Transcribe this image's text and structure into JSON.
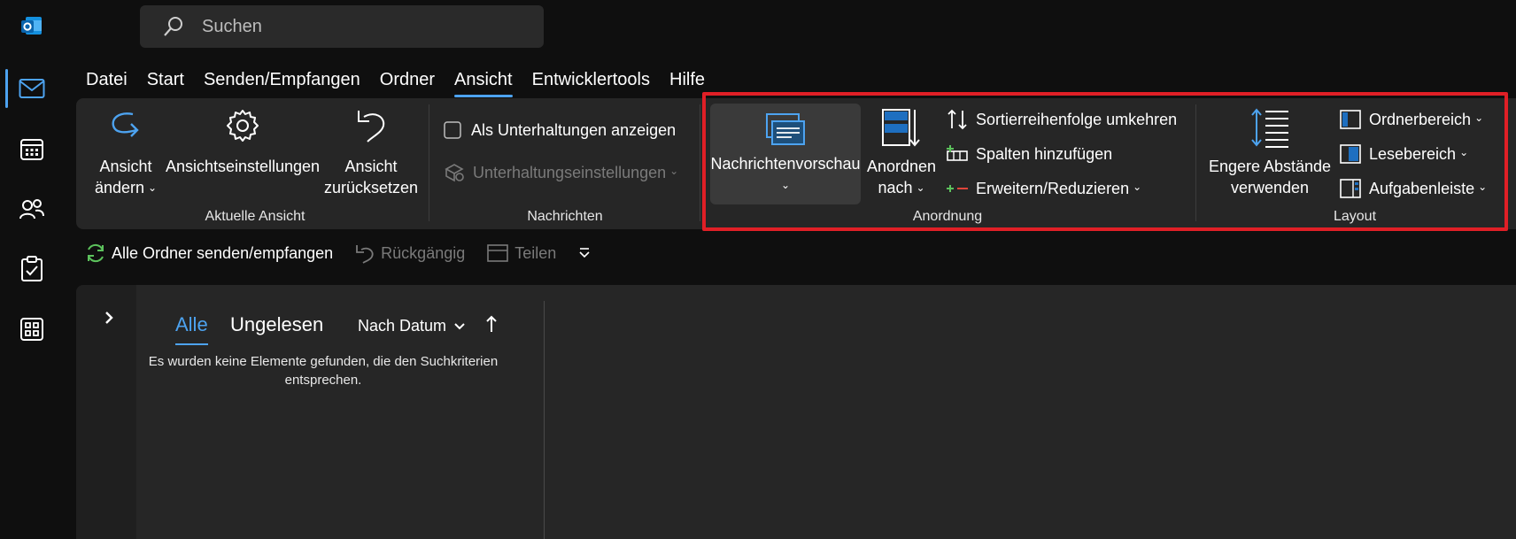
{
  "search": {
    "placeholder": "Suchen"
  },
  "menu": {
    "tabs": [
      "Datei",
      "Start",
      "Senden/Empfangen",
      "Ordner",
      "Ansicht",
      "Entwicklertools",
      "Hilfe"
    ],
    "active": "Ansicht"
  },
  "ribbon": {
    "aktuelle_ansicht": {
      "label": "Aktuelle Ansicht",
      "change_view_1": "Ansicht",
      "change_view_2": "ändern",
      "view_settings": "Ansichtseinstellungen",
      "reset_view_1": "Ansicht",
      "reset_view_2": "zurücksetzen"
    },
    "nachrichten": {
      "label": "Nachrichten",
      "show_as_conversations": "Als Unterhaltungen anzeigen",
      "conversation_settings": "Unterhaltungseinstellungen"
    },
    "anordnung": {
      "label": "Anordnung",
      "message_preview": "Nachrichtenvorschau",
      "arrange_by_1": "Anordnen",
      "arrange_by_2": "nach",
      "reverse_sort": "Sortierreihenfolge umkehren",
      "add_columns": "Spalten hinzufügen",
      "expand_collapse": "Erweitern/Reduzieren"
    },
    "layout": {
      "label": "Layout",
      "tighter_spacing_1": "Engere Abstände",
      "tighter_spacing_2": "verwenden",
      "folder_pane": "Ordnerbereich",
      "reading_pane": "Lesebereich",
      "todo_bar": "Aufgabenleiste"
    }
  },
  "quick_access": {
    "send_receive_all": "Alle Ordner senden/empfangen",
    "undo": "Rückgängig",
    "share": "Teilen"
  },
  "message_list": {
    "filter_all": "Alle",
    "filter_unread": "Ungelesen",
    "sort_by": "Nach Datum",
    "empty_message": "Es wurden keine Elemente gefunden, die den Suchkriterien entsprechen."
  },
  "colors": {
    "accent": "#4da3f0",
    "highlight_border": "#e01f26",
    "ribbon_bg": "#262626",
    "window_bg": "#0f0f0f"
  },
  "icons": {
    "rail": [
      "outlook-logo-icon",
      "mail-icon",
      "calendar-icon",
      "people-icon",
      "tasks-icon",
      "apps-icon"
    ]
  }
}
